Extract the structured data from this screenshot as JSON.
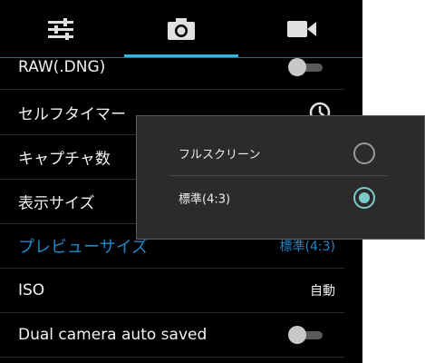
{
  "tabs": [
    {
      "icon": "sliders-icon"
    },
    {
      "icon": "camera-icon",
      "selected": true
    },
    {
      "icon": "video-camera-icon"
    }
  ],
  "colors": {
    "accent": "#33b5e5",
    "text": "#f2f2f2",
    "dialog_bg": "#2b2b2b",
    "radio_on": "#7ccccc"
  },
  "settings": [
    {
      "label": "RAW(.DNG)",
      "control": "toggle",
      "on": false
    },
    {
      "label": "セルフタイマー",
      "control": "clock-icon"
    },
    {
      "label": "キャプチャ数"
    },
    {
      "label": "表示サイズ"
    },
    {
      "label": "プレビューサイズ",
      "value": "標準(4:3)",
      "highlighted": true
    },
    {
      "label": "ISO",
      "value": "自動"
    },
    {
      "label": "Dual camera auto saved",
      "control": "toggle",
      "on": false
    }
  ],
  "dialog": {
    "options": [
      {
        "label": "フルスクリーン",
        "selected": false
      },
      {
        "label": "標準(4:3)",
        "selected": true
      }
    ]
  }
}
